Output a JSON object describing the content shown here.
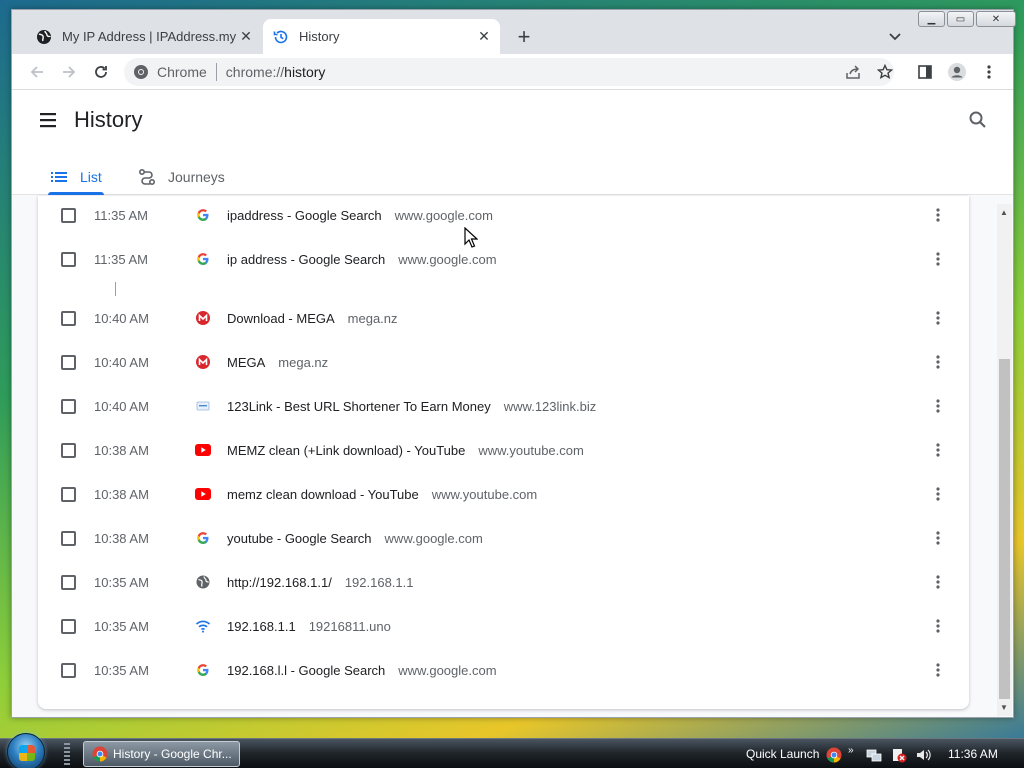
{
  "tabs": [
    {
      "title": "My IP Address | IPAddress.my",
      "icon": "globe-icon",
      "active": false
    },
    {
      "title": "History",
      "icon": "history-icon",
      "active": true
    }
  ],
  "toolbar": {
    "chip_label": "Chrome",
    "url_scheme": "chrome://",
    "url_path": "history"
  },
  "page": {
    "title": "History",
    "tabs": [
      {
        "label": "List",
        "selected": true
      },
      {
        "label": "Journeys",
        "selected": false
      }
    ]
  },
  "history": [
    {
      "time": "11:35 AM",
      "title": "ipaddress - Google Search",
      "domain": "www.google.com",
      "favicon": "google-icon"
    },
    {
      "time": "11:35 AM",
      "title": "ip address - Google Search",
      "domain": "www.google.com",
      "favicon": "google-icon"
    },
    {
      "time": "10:40 AM",
      "title": "Download - MEGA",
      "domain": "mega.nz",
      "favicon": "mega-icon"
    },
    {
      "time": "10:40 AM",
      "title": "MEGA",
      "domain": "mega.nz",
      "favicon": "mega-icon"
    },
    {
      "time": "10:40 AM",
      "title": "123Link - Best URL Shortener To Earn Money",
      "domain": "www.123link.biz",
      "favicon": "123link-icon"
    },
    {
      "time": "10:38 AM",
      "title": "MEMZ clean (+Link download) - YouTube",
      "domain": "www.youtube.com",
      "favicon": "youtube-icon"
    },
    {
      "time": "10:38 AM",
      "title": "memz clean download - YouTube",
      "domain": "www.youtube.com",
      "favicon": "youtube-icon"
    },
    {
      "time": "10:38 AM",
      "title": "youtube - Google Search",
      "domain": "www.google.com",
      "favicon": "google-icon"
    },
    {
      "time": "10:35 AM",
      "title": "http://192.168.1.1/",
      "domain": "192.168.1.1",
      "favicon": "globe-icon"
    },
    {
      "time": "10:35 AM",
      "title": "192.168.1.1",
      "domain": "19216811.uno",
      "favicon": "wifi-icon"
    },
    {
      "time": "10:35 AM",
      "title": "192.168.l.l - Google Search",
      "domain": "www.google.com",
      "favicon": "google-icon"
    }
  ],
  "taskbar": {
    "window_label": "History - Google Chr...",
    "quick_launch": "Quick Launch",
    "chevron": "»",
    "clock": "11:36 AM"
  },
  "colors": {
    "accent": "#1a73e8",
    "youtube": "#ff0000",
    "mega": "#d9272e"
  }
}
